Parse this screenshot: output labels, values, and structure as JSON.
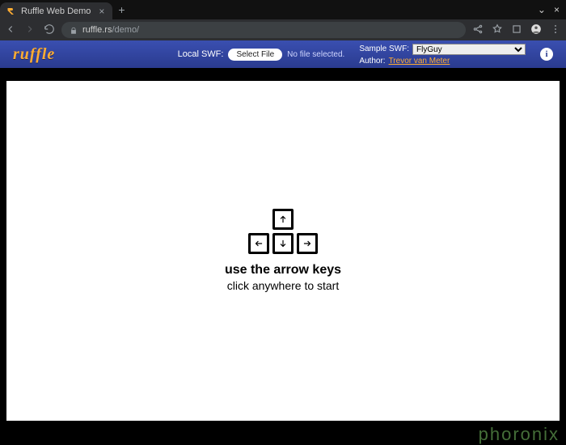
{
  "browser": {
    "tab_title": "Ruffle Web Demo",
    "url_host": "ruffle.rs",
    "url_path": "/demo/",
    "window_controls": {
      "minimize": "⌄",
      "close": "×"
    }
  },
  "header": {
    "logo_text": "ruffle",
    "local_swf_label": "Local SWF:",
    "select_file_label": "Select File",
    "no_file_text": "No file selected.",
    "sample_swf_label": "Sample SWF:",
    "sample_selected": "FlyGuy",
    "author_label": "Author:",
    "author_name": "Trevor van Meter",
    "info_glyph": "i"
  },
  "game": {
    "instruction_line1": "use the arrow keys",
    "instruction_line2": "click anywhere to start"
  },
  "watermark": "phoronix"
}
